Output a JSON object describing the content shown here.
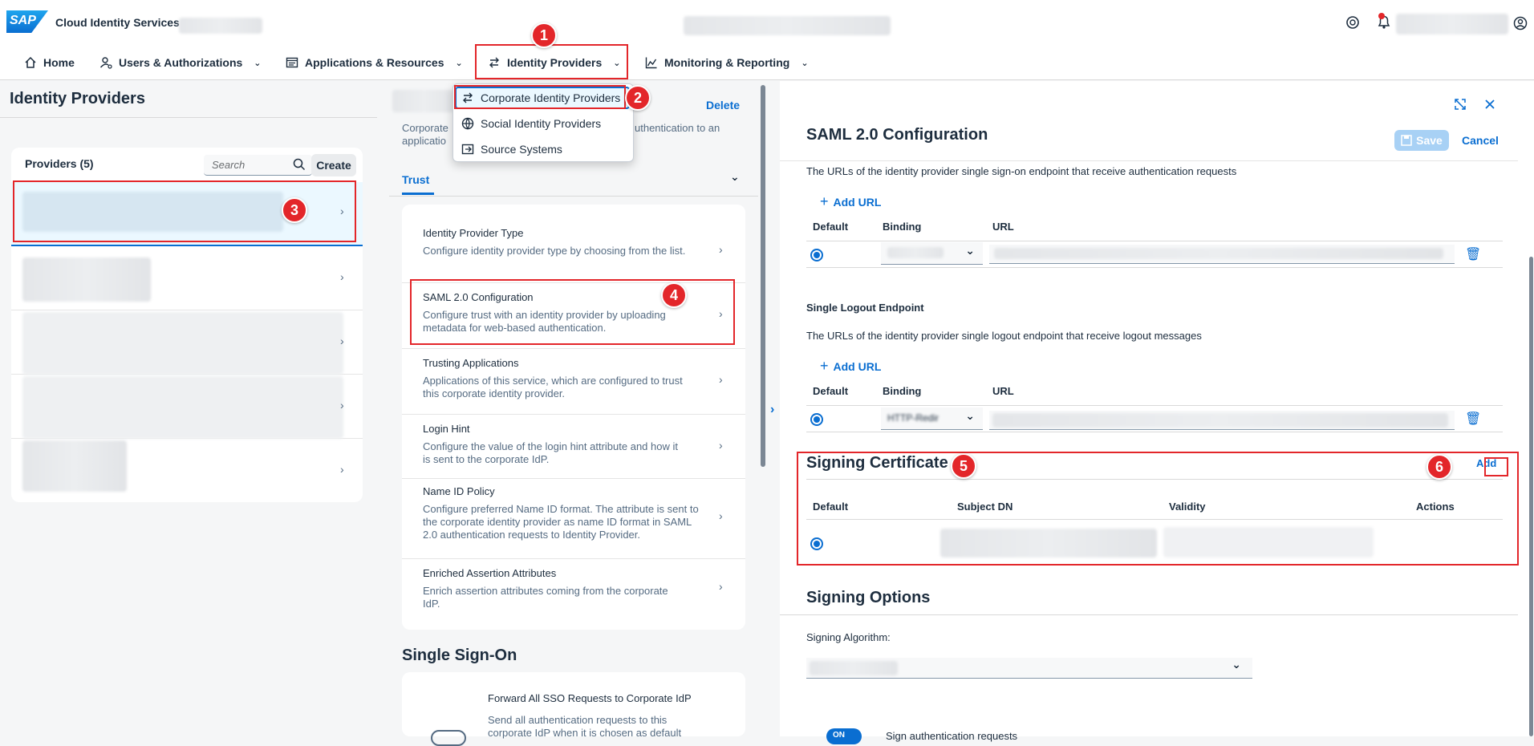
{
  "shell": {
    "logo_text": "SAP",
    "app_name": "Cloud Identity Services"
  },
  "nav": {
    "home": "Home",
    "users": "Users & Authorizations",
    "applications": "Applications & Resources",
    "identity_providers": "Identity Providers",
    "monitoring": "Monitoring & Reporting"
  },
  "dropdown": {
    "items": [
      "Corporate Identity Providers",
      "Social Identity Providers",
      "Source Systems"
    ]
  },
  "left": {
    "title": "Identity Providers",
    "providers_label": "Providers (5)",
    "search_placeholder": "Search",
    "create": "Create"
  },
  "middle": {
    "delete": "Delete",
    "description_start": "Corporate",
    "description_end": "uthentication to an",
    "description_line2": "applicatio",
    "trust_tab": "Trust",
    "items": [
      {
        "title": "Identity Provider Type",
        "desc": "Configure identity provider type by choosing from the list."
      },
      {
        "title": "SAML 2.0 Configuration",
        "desc": "Configure trust with an identity provider by uploading metadata for web-based authentication."
      },
      {
        "title": "Trusting Applications",
        "desc": "Applications of this service, which are configured to trust this corporate identity provider."
      },
      {
        "title": "Login Hint",
        "desc": "Configure the value of the login hint attribute and how it is sent to the corporate IdP."
      },
      {
        "title": "Name ID Policy",
        "desc": "Configure preferred Name ID format. The attribute is sent to the corporate identity provider as name ID format in SAML 2.0 authentication requests to Identity Provider."
      },
      {
        "title": "Enriched Assertion Attributes",
        "desc": "Enrich assertion attributes coming from the corporate IdP."
      }
    ],
    "sso_title": "Single Sign-On",
    "sso_item_title": "Forward All SSO Requests to Corporate IdP",
    "sso_item_desc": "Send all authentication requests to this corporate IdP when it is chosen as default"
  },
  "right": {
    "title": "SAML 2.0 Configuration",
    "save": "Save",
    "cancel": "Cancel",
    "sso_endpoint_desc": "The URLs of the identity provider single sign-on endpoint that receive authentication requests",
    "add_url": "Add URL",
    "col_default": "Default",
    "col_binding": "Binding",
    "col_url": "URL",
    "slo_title": "Single Logout Endpoint",
    "slo_desc": "The URLs of the identity provider single logout endpoint that receive logout messages",
    "slo_binding_partial": "HTTP-Redir",
    "signing_cert_title": "Signing Certificate",
    "add": "Add",
    "col_subject": "Subject DN",
    "col_validity": "Validity",
    "col_actions": "Actions",
    "signing_options_title": "Signing Options",
    "signing_algorithm_label": "Signing Algorithm:",
    "sign_auth_requests": "Sign authentication requests",
    "toggle_on": "ON"
  },
  "annotations": [
    "1",
    "2",
    "3",
    "4",
    "5",
    "6"
  ]
}
